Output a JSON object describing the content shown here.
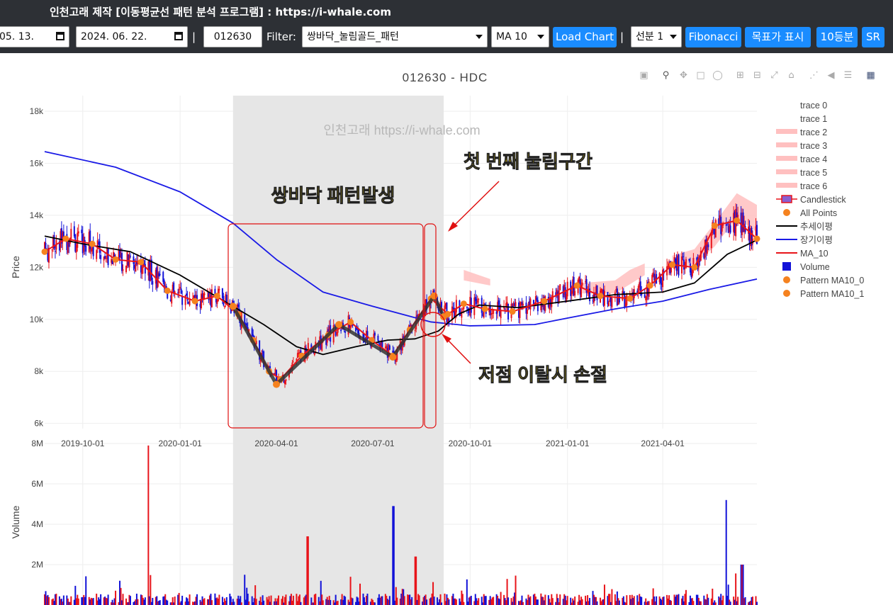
{
  "app": {
    "title": "인천고래 제작 [이동평균선 패턴 분석 프로그램] : https://i-whale.com"
  },
  "toolbar": {
    "start_date": "05. 13.",
    "end_date": "2024. 06. 22.",
    "separator": "|",
    "ticker": "012630",
    "filter_label": "Filter:",
    "filter_value": "쌍바닥_눌림골드_패턴",
    "ma_value": "MA 10",
    "load_button": "Load Chart",
    "separator2": "|",
    "line_select": "선분 1",
    "fibonacci_button": "Fibonacci",
    "target_button": "목표가 표시",
    "tenth_button": "10등분",
    "sr_button": "SR"
  },
  "modebar": {
    "icons": [
      "camera-icon",
      "zoom-icon",
      "pan-icon",
      "box-select-icon",
      "lasso-icon",
      "zoom-in-icon",
      "zoom-out-icon",
      "autoscale-icon",
      "reset-axes-icon",
      "spike-lines-icon",
      "hover-closest-icon",
      "hover-compare-icon",
      "plotly-logo-icon"
    ]
  },
  "chart": {
    "title": "012630 - HDC",
    "watermark": "인천고래 https://i-whale.com",
    "y_label": "Price",
    "volume_label": "Volume",
    "annotations": {
      "double_bottom": "쌍바닥 패턴발생",
      "first_pullback": "첫 번째 눌림구간",
      "stop_loss": "저점 이탈시 손절"
    },
    "colors": {
      "up": "#e8141a",
      "down": "#1212d8",
      "ma10": "#e8141a",
      "trend": "#000000",
      "long": "#1a1ae6",
      "pattern": "#f5821f",
      "band": "#ffc0c0",
      "shade": "#e6e6e6"
    }
  },
  "legend": [
    {
      "label": "trace 0",
      "kind": "none"
    },
    {
      "label": "trace 1",
      "kind": "none"
    },
    {
      "label": "trace 2",
      "kind": "band"
    },
    {
      "label": "trace 3",
      "kind": "band"
    },
    {
      "label": "trace 4",
      "kind": "band"
    },
    {
      "label": "trace 5",
      "kind": "band"
    },
    {
      "label": "trace 6",
      "kind": "band"
    },
    {
      "label": "Candlestick",
      "kind": "candle"
    },
    {
      "label": "All Points",
      "kind": "dot"
    },
    {
      "label": "추세이평",
      "kind": "line-black"
    },
    {
      "label": "장기이평",
      "kind": "line-blue"
    },
    {
      "label": "MA_10",
      "kind": "line-red"
    },
    {
      "label": "Volume",
      "kind": "square"
    },
    {
      "label": "Pattern MA10_0",
      "kind": "dot"
    },
    {
      "label": "Pattern MA10_1",
      "kind": "dot"
    }
  ],
  "chart_data": {
    "type": "line",
    "y_ticks": [
      "6k",
      "8k",
      "10k",
      "12k",
      "14k",
      "16k",
      "18k"
    ],
    "ylim": [
      5800,
      18600
    ],
    "x_ticks": [
      "2019-10-01",
      "2020-01-01",
      "2020-04-01",
      "2020-07-01",
      "2020-10-01",
      "2021-01-01",
      "2021-04-01"
    ],
    "volume_ticks": [
      "2M",
      "4M",
      "6M",
      "8M"
    ],
    "volume_ylim": [
      0,
      8000000
    ],
    "xlim": [
      "2019-08-26",
      "2021-06-29"
    ],
    "shaded_period": [
      "2020-02-20",
      "2020-09-06"
    ],
    "series": [
      {
        "name": "장기이평",
        "color": "#1a1ae6",
        "points": [
          [
            "2019-08-26",
            16450
          ],
          [
            "2019-11-01",
            15850
          ],
          [
            "2020-01-01",
            14900
          ],
          [
            "2020-02-20",
            13700
          ],
          [
            "2020-04-01",
            12300
          ],
          [
            "2020-05-15",
            11050
          ],
          [
            "2020-07-01",
            10500
          ],
          [
            "2020-08-25",
            9900
          ],
          [
            "2020-10-01",
            9750
          ],
          [
            "2020-12-01",
            9800
          ],
          [
            "2021-01-01",
            10050
          ],
          [
            "2021-02-15",
            10400
          ],
          [
            "2021-04-01",
            10700
          ],
          [
            "2021-05-15",
            11150
          ],
          [
            "2021-06-29",
            11550
          ]
        ]
      },
      {
        "name": "추세이평",
        "color": "#000000",
        "points": [
          [
            "2019-08-26",
            13200
          ],
          [
            "2019-10-01",
            12900
          ],
          [
            "2019-11-15",
            12600
          ],
          [
            "2020-01-01",
            11700
          ],
          [
            "2020-02-20",
            10500
          ],
          [
            "2020-03-20",
            9800
          ],
          [
            "2020-04-20",
            8950
          ],
          [
            "2020-05-15",
            8650
          ],
          [
            "2020-06-15",
            8950
          ],
          [
            "2020-07-15",
            9200
          ],
          [
            "2020-08-10",
            9250
          ],
          [
            "2020-09-01",
            9550
          ],
          [
            "2020-09-20",
            10200
          ],
          [
            "2020-10-10",
            10550
          ],
          [
            "2020-11-15",
            10450
          ],
          [
            "2021-01-01",
            10700
          ],
          [
            "2021-02-15",
            10950
          ],
          [
            "2021-04-01",
            11050
          ],
          [
            "2021-05-01",
            11400
          ],
          [
            "2021-06-01",
            12500
          ],
          [
            "2021-06-29",
            13050
          ]
        ]
      },
      {
        "name": "MA_10",
        "color": "#e8141a",
        "points": [
          [
            "2019-08-26",
            12600
          ],
          [
            "2019-09-15",
            13100
          ],
          [
            "2019-10-10",
            12900
          ],
          [
            "2019-11-01",
            12300
          ],
          [
            "2019-11-25",
            12200
          ],
          [
            "2019-12-20",
            11100
          ],
          [
            "2020-01-15",
            10700
          ],
          [
            "2020-02-05",
            10900
          ],
          [
            "2020-02-25",
            10200
          ],
          [
            "2020-03-10",
            9200
          ],
          [
            "2020-03-25",
            8000
          ],
          [
            "2020-04-05",
            7700
          ],
          [
            "2020-04-25",
            8600
          ],
          [
            "2020-05-20",
            9400
          ],
          [
            "2020-06-10",
            9900
          ],
          [
            "2020-06-30",
            9200
          ],
          [
            "2020-07-20",
            8600
          ],
          [
            "2020-08-05",
            9600
          ],
          [
            "2020-08-25",
            10800
          ],
          [
            "2020-09-10",
            10200
          ],
          [
            "2020-09-25",
            10600
          ],
          [
            "2020-10-15",
            10400
          ],
          [
            "2020-11-10",
            10300
          ],
          [
            "2020-12-10",
            10700
          ],
          [
            "2021-01-10",
            11300
          ],
          [
            "2021-02-01",
            10900
          ],
          [
            "2021-03-01",
            10800
          ],
          [
            "2021-03-20",
            11300
          ],
          [
            "2021-04-10",
            12100
          ],
          [
            "2021-05-01",
            12000
          ],
          [
            "2021-05-20",
            13600
          ],
          [
            "2021-06-10",
            13800
          ],
          [
            "2021-06-29",
            13100
          ]
        ]
      }
    ],
    "pattern_zigzag": {
      "name": "Pattern MA10_0",
      "points": [
        [
          "2020-02-20",
          10500
        ],
        [
          "2020-04-01",
          7500
        ],
        [
          "2020-05-30",
          9800
        ],
        [
          "2020-07-20",
          8550
        ],
        [
          "2020-08-28",
          10900
        ],
        [
          "2020-09-06",
          10100
        ]
      ]
    },
    "band_areas": [
      {
        "points": [
          [
            "2020-09-25",
            11900
          ],
          [
            "2020-10-20",
            11550
          ],
          [
            "2020-10-20",
            11300
          ],
          [
            "2020-09-25",
            11500
          ]
        ]
      },
      {
        "points": [
          [
            "2021-01-15",
            11400
          ],
          [
            "2021-02-15",
            11500
          ],
          [
            "2021-03-01",
            11900
          ],
          [
            "2021-03-15",
            12150
          ],
          [
            "2021-03-15",
            11700
          ],
          [
            "2021-02-15",
            11000
          ],
          [
            "2021-01-15",
            11000
          ]
        ]
      },
      {
        "points": [
          [
            "2021-04-10",
            12450
          ],
          [
            "2021-05-01",
            12700
          ],
          [
            "2021-05-20",
            13700
          ],
          [
            "2021-06-10",
            14850
          ],
          [
            "2021-06-29",
            14400
          ],
          [
            "2021-06-29",
            13350
          ],
          [
            "2021-06-10",
            13900
          ],
          [
            "2021-05-20",
            12800
          ],
          [
            "2021-05-01",
            12100
          ],
          [
            "2021-04-10",
            12000
          ]
        ]
      }
    ],
    "candles_seed": 17,
    "volume_spikes": [
      [
        "2019-12-01",
        7900000
      ],
      [
        "2020-05-01",
        3400000
      ],
      [
        "2020-07-20",
        4900000
      ],
      [
        "2020-08-10",
        2400000
      ],
      [
        "2021-05-30",
        5200000
      ],
      [
        "2021-06-15",
        2000000
      ]
    ]
  }
}
